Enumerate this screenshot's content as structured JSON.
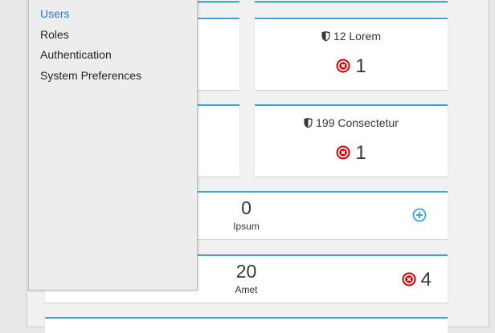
{
  "menu": {
    "items": [
      {
        "label": "Users",
        "active": true
      },
      {
        "label": "Roles",
        "active": false
      },
      {
        "label": "Authentication",
        "active": false
      },
      {
        "label": "System Preferences",
        "active": false
      }
    ]
  },
  "cards": [
    {
      "title_count": "12",
      "title_text": "Lorem",
      "error_count": "1",
      "shield_icon": "shield-icon",
      "error_icon": "error-circle-icon"
    },
    {
      "title_count": "199",
      "title_text": "Consectetur",
      "error_count": "1",
      "shield_icon": "shield-icon",
      "error_icon": "error-circle-icon"
    }
  ],
  "aggregate": [
    {
      "count": "0",
      "label": "Ipsum",
      "action_icon": "add-circle-icon"
    },
    {
      "count": "20",
      "label": "Amet",
      "error_count": "4",
      "error_icon": "error-circle-icon"
    }
  ],
  "colors": {
    "accent": "#39a5dc",
    "error": "#cc0000",
    "active_link": "#2b7bd0"
  }
}
